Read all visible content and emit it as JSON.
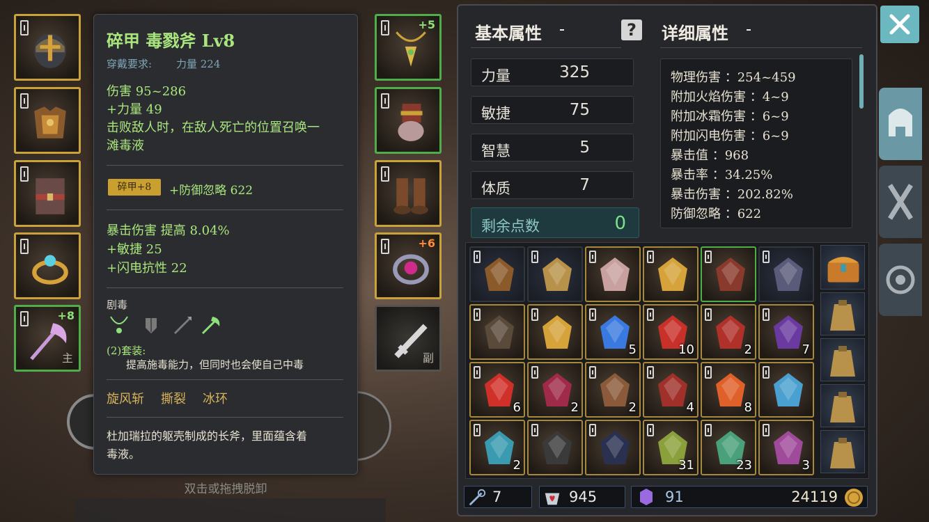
{
  "tooltip": {
    "title": "碎甲 毒戮斧 Lv8",
    "requirement_label": "穿戴要求:",
    "requirement_value": "力量 224",
    "base_stats": [
      "伤害 95~286",
      "+力量 49"
    ],
    "effect_line1": "击败敌人时，在敌人死亡的位置召唤一",
    "effect_line2": "滩毒液",
    "enchant_badge": "碎甲+8",
    "enchant_stat": "+防御忽略 622",
    "extra_stats": [
      "暴击伤害 提高 8.04%",
      "+敏捷 25",
      "+闪电抗性 22"
    ],
    "set_name": "剧毒",
    "set_bonus_label": "(2)套装:",
    "set_bonus_text": "提高施毒能力，但同时也会使自己中毒",
    "skills": [
      "旋风斩",
      "撕裂",
      "冰环"
    ],
    "description_line1": "杜加瑞拉的躯壳制成的长斧，里面蕴含着",
    "description_line2": "毒液。",
    "footer_hint": "双击或拖拽脱卸"
  },
  "equipment": {
    "left_slots": [
      {
        "name": "helmet",
        "plus": ""
      },
      {
        "name": "armor",
        "plus": ""
      },
      {
        "name": "belt",
        "plus": ""
      },
      {
        "name": "ring",
        "plus": ""
      },
      {
        "name": "weapon-axe",
        "plus": "+8",
        "tag": "主"
      }
    ],
    "right_slots": [
      {
        "name": "necklace",
        "plus": "+5"
      },
      {
        "name": "gloves",
        "plus": ""
      },
      {
        "name": "boots",
        "plus": ""
      },
      {
        "name": "ring",
        "plus": "+6"
      },
      {
        "name": "sword",
        "plus": "",
        "tag": "副"
      }
    ]
  },
  "attributes": {
    "basic_title": "基本属性",
    "detail_title": "详细属性",
    "help_icon": "?",
    "stats": [
      {
        "label": "力量",
        "value": "325"
      },
      {
        "label": "敏捷",
        "value": "75"
      },
      {
        "label": "智慧",
        "value": "5"
      },
      {
        "label": "体质",
        "value": "7"
      }
    ],
    "remaining_label": "剩余点数",
    "remaining_value": "0",
    "details": [
      "物理伤害 ：254~459",
      "附加火焰伤害 ：4~9",
      "附加冰霜伤害 ：6~9",
      "附加闪电伤害 ：6~9",
      "暴击值 ：968",
      "暴击率 ：34.25%",
      "暴击伤害 ：202.82%",
      "防御忽略 ：622"
    ]
  },
  "inventory": {
    "rows": [
      [
        {
          "item": "pouch",
          "qty": ""
        },
        {
          "item": "bag",
          "qty": ""
        },
        {
          "item": "armor",
          "qty": ""
        },
        {
          "item": "ring",
          "qty": ""
        },
        {
          "item": "gloves",
          "qty": ""
        },
        {
          "item": "helmet",
          "qty": ""
        }
      ],
      [
        {
          "item": "boots",
          "qty": ""
        },
        {
          "item": "ring",
          "qty": ""
        },
        {
          "item": "blue-orb",
          "qty": "5"
        },
        {
          "item": "red-crystal",
          "qty": "10"
        },
        {
          "item": "red-ore",
          "qty": "2"
        },
        {
          "item": "purple-crystal",
          "qty": "7"
        }
      ],
      [
        {
          "item": "red-stone",
          "qty": "6"
        },
        {
          "item": "red-egg",
          "qty": "2"
        },
        {
          "item": "wood",
          "qty": "2"
        },
        {
          "item": "red-claw",
          "qty": "4"
        },
        {
          "item": "orange-gem",
          "qty": "8"
        },
        {
          "item": "blue-gem",
          "qty": ""
        }
      ],
      [
        {
          "item": "teal-shards",
          "qty": "2"
        },
        {
          "item": "black-ore",
          "qty": ""
        },
        {
          "item": "dark-plates",
          "qty": ""
        },
        {
          "item": "spiral-scroll",
          "qty": "31"
        },
        {
          "item": "jade-emblem",
          "qty": "23"
        },
        {
          "item": "purple-emblem",
          "qty": "3"
        }
      ]
    ]
  },
  "currency": {
    "keys": "7",
    "hearts": "945",
    "gems": "91",
    "gold": "24119"
  },
  "colors": {
    "gold_border": "#c9a33a",
    "green_border": "#4fae4a",
    "accent_teal": "#6a98a4"
  }
}
